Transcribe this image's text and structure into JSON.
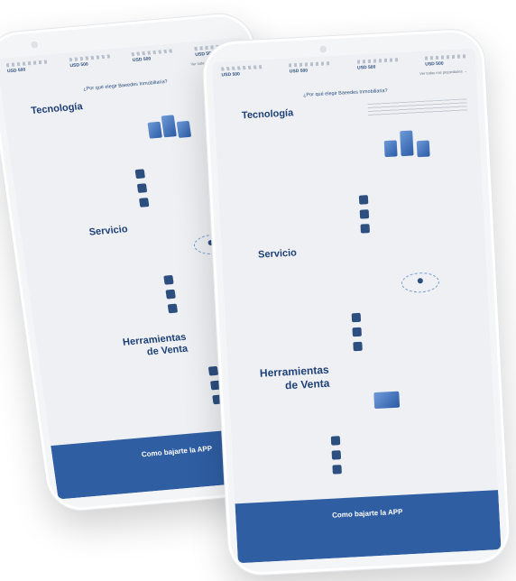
{
  "prices": [
    {
      "icons": "bed-bath-car-icons",
      "value": "USD 500"
    },
    {
      "icons": "bed-bath-car-icons",
      "value": "USD 500"
    },
    {
      "icons": "bed-bath-car-icons",
      "value": "USD 500"
    },
    {
      "icons": "bed-bath-car-icons",
      "value": "USD 500"
    }
  ],
  "see_more": "Ver todas mis propiedades →",
  "why_title": "¿Por qué elegir Baeedes Inmobiliaria?",
  "sections": {
    "tecnologia": {
      "title": "Tecnología"
    },
    "servicio": {
      "title": "Servicio"
    },
    "herramientas": {
      "title_line1": "Herramientas",
      "title_line2": "de Venta"
    }
  },
  "footer": {
    "title": "Como bajarte la APP"
  },
  "colors": {
    "brand": "#2f5ea3",
    "title": "#1f4178",
    "background": "#eef0f3"
  }
}
